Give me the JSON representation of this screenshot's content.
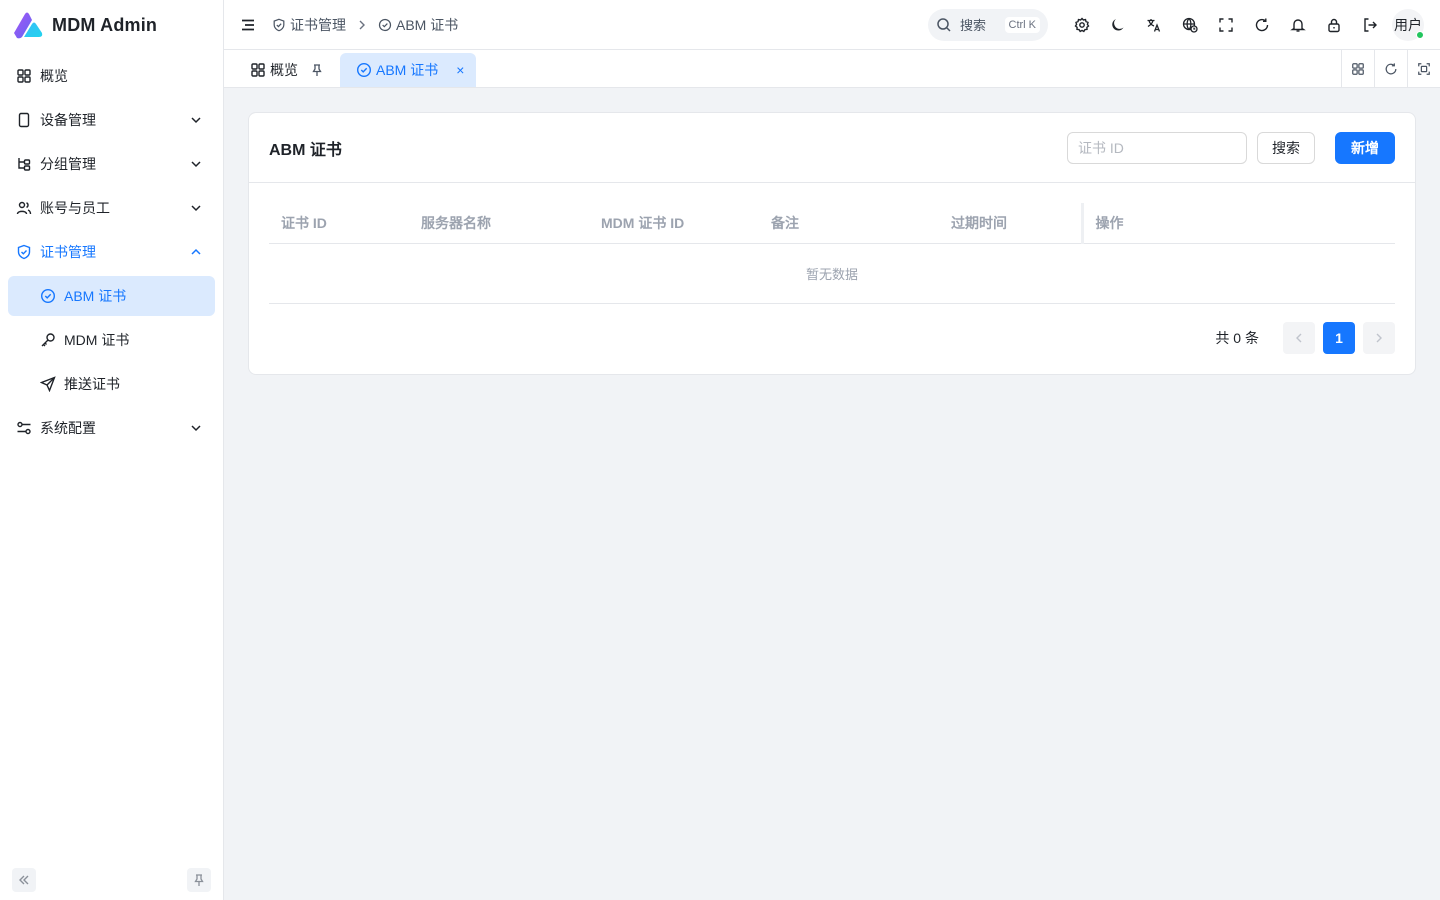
{
  "app": {
    "title": "MDM Admin"
  },
  "sidebar": {
    "items": [
      {
        "label": "概览",
        "icon": "grid-icon"
      },
      {
        "label": "设备管理",
        "icon": "device-icon"
      },
      {
        "label": "分组管理",
        "icon": "tree-icon"
      },
      {
        "label": "账号与员工",
        "icon": "users-icon"
      },
      {
        "label": "证书管理",
        "icon": "shield-check-icon",
        "expanded": true
      },
      {
        "label": "系统配置",
        "icon": "settings-sliders-icon"
      }
    ],
    "cert_children": [
      {
        "label": "ABM 证书",
        "icon": "check-circle-icon",
        "active": true
      },
      {
        "label": "MDM 证书",
        "icon": "key-icon"
      },
      {
        "label": "推送证书",
        "icon": "send-icon"
      }
    ]
  },
  "header": {
    "breadcrumb": [
      "证书管理",
      "ABM 证书"
    ],
    "search": {
      "label": "搜索",
      "shortcut": "Ctrl K"
    },
    "user": {
      "label": "用户",
      "online_color": "#22c55e"
    }
  },
  "tabs": [
    {
      "label": "概览",
      "pinned": true
    },
    {
      "label": "ABM 证书",
      "active": true,
      "close": "×"
    }
  ],
  "page": {
    "title": "ABM 证书",
    "id_input": {
      "placeholder": "证书 ID",
      "value": ""
    },
    "search_label": "搜索",
    "add_label": "新增",
    "table": {
      "columns": [
        "证书 ID",
        "服务器名称",
        "MDM 证书 ID",
        "备注",
        "过期时间",
        "操作"
      ],
      "rows": [],
      "empty_text": "暂无数据"
    },
    "pagination": {
      "total_text": "共 0 条",
      "current_page": "1"
    }
  },
  "colors": {
    "accent": "#1677ff",
    "active_bg": "#dbeafe",
    "bg": "#f1f3f6"
  }
}
